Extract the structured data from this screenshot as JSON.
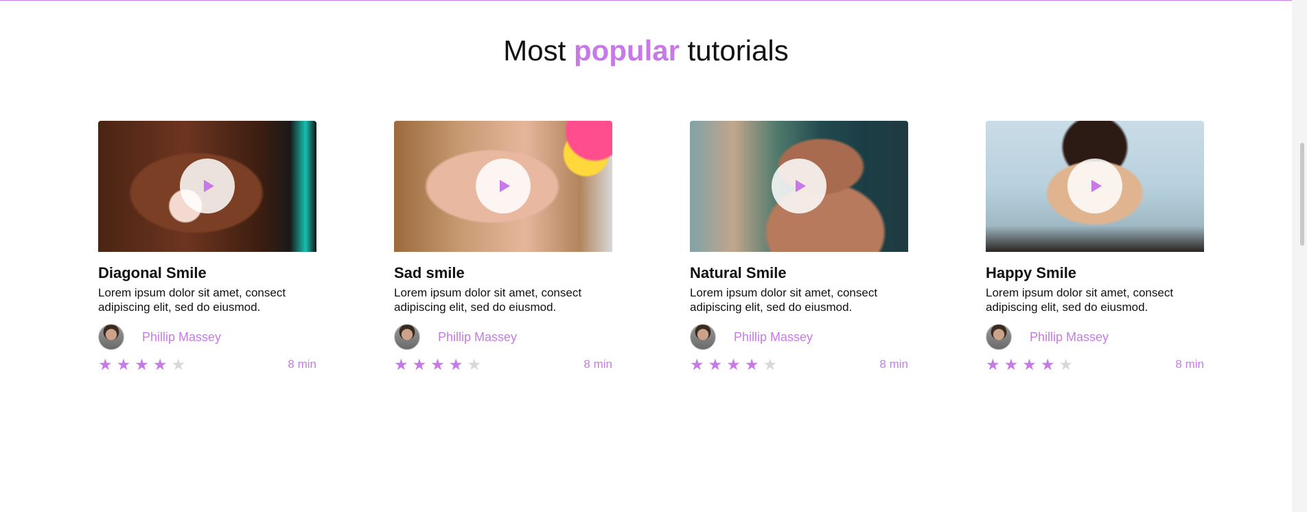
{
  "heading": {
    "prefix": "Most",
    "accent": "popular",
    "suffix": "tutorials"
  },
  "colors": {
    "accent": "#c779e8",
    "star_off": "#d8d8d8",
    "text": "#111111"
  },
  "cards": [
    {
      "title": "Diagonal Smile",
      "description": "Lorem ipsum dolor sit amet, consect adipiscing elit, sed do eiusmod.",
      "author": "Phillip Massey",
      "rating": 4,
      "rating_max": 5,
      "duration": "8 min",
      "icon": "play-icon"
    },
    {
      "title": "Sad smile",
      "description": "Lorem ipsum dolor sit amet, consect adipiscing elit, sed do eiusmod.",
      "author": "Phillip Massey",
      "rating": 4,
      "rating_max": 5,
      "duration": "8 min",
      "icon": "play-icon"
    },
    {
      "title": "Natural Smile",
      "description": "Lorem ipsum dolor sit amet, consect adipiscing elit, sed do eiusmod.",
      "author": "Phillip Massey",
      "rating": 4,
      "rating_max": 5,
      "duration": "8 min",
      "icon": "play-icon"
    },
    {
      "title": "Happy Smile",
      "description": "Lorem ipsum dolor sit amet, consect adipiscing elit, sed do eiusmod.",
      "author": "Phillip Massey",
      "rating": 4,
      "rating_max": 5,
      "duration": "8 min",
      "icon": "play-icon"
    }
  ]
}
